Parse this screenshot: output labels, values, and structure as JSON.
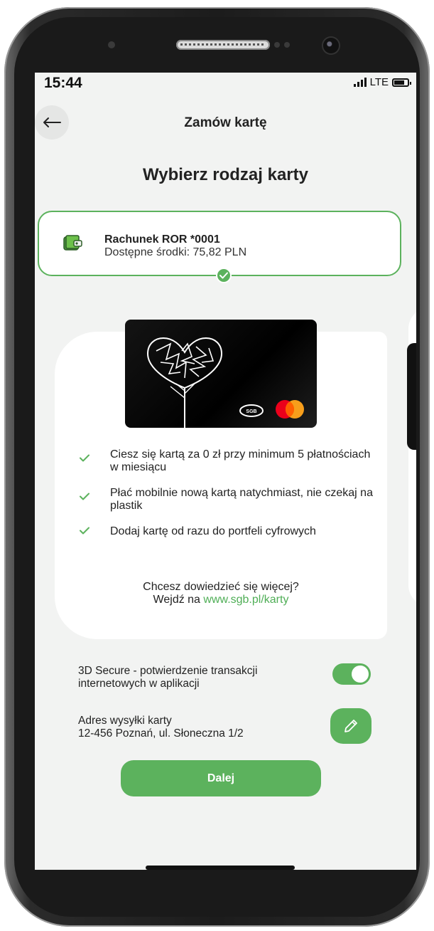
{
  "status": {
    "time": "15:44",
    "network": "LTE"
  },
  "header": {
    "title": "Zamów kartę"
  },
  "page": {
    "heading": "Wybierz rodzaj karty"
  },
  "account": {
    "name": "Rachunek ROR *0001",
    "funds": "Dostępne środki: 75,82 PLN"
  },
  "card": {
    "brand": "SGB"
  },
  "benefits": [
    {
      "text": "Ciesz się kartą za 0 zł przy minimum 5 płatnościach w miesiącu"
    },
    {
      "text": "Płać mobilnie nową kartą natychmiast, nie czekaj na plastik"
    },
    {
      "text": "Dodaj kartę od razu do portfeli cyfrowych"
    }
  ],
  "learn_more": {
    "question": "Chcesz dowiedzieć się więcej?",
    "prefix": "Wejdź na ",
    "link": "www.sgb.pl/karty"
  },
  "secure": {
    "label": "3D Secure - potwierdzenie transakcji internetowych w aplikacji",
    "enabled": true
  },
  "shipping": {
    "label": "Adres wysyłki karty",
    "address": "12-456 Poznań, ul. Słoneczna 1/2"
  },
  "actions": {
    "next_label": "Dalej"
  },
  "colors": {
    "accent": "#5cb25d",
    "link": "#4fae56",
    "background": "#f2f3f2"
  },
  "icons": [
    "back-arrow-icon",
    "wallet-icon",
    "check-icon",
    "pencil-icon"
  ]
}
